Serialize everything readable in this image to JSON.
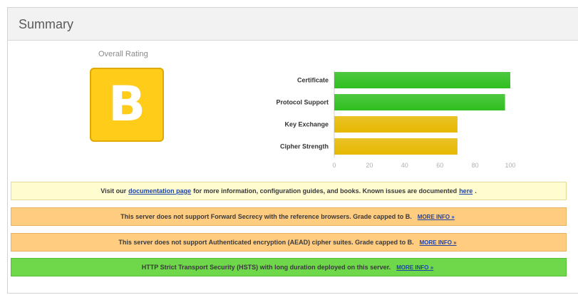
{
  "panel": {
    "title": "Summary"
  },
  "rating": {
    "label": "Overall Rating",
    "grade": "B"
  },
  "colors": {
    "pass": "#2fbf1f",
    "warn": "#e6b800",
    "grade_bg": "#ffcc1a",
    "info_bg": "#fffccf",
    "warning_bg": "#ffcc80",
    "success_bg": "#6ed84a"
  },
  "chart_data": {
    "type": "bar",
    "orientation": "horizontal",
    "categories": [
      "Certificate",
      "Protocol Support",
      "Key Exchange",
      "Cipher Strength"
    ],
    "values": [
      100,
      97,
      70,
      70
    ],
    "colors": [
      "pass",
      "pass",
      "warn",
      "warn"
    ],
    "xlim": [
      0,
      100
    ],
    "ticks": [
      0,
      20,
      40,
      60,
      80,
      100
    ],
    "grid": false
  },
  "notices": {
    "info": {
      "before": "Visit our",
      "link1": "documentation page",
      "middle": "for more information, configuration guides, and books. Known issues are documented",
      "link2": "here",
      "after": "."
    },
    "warn1": {
      "text": "This server does not support Forward Secrecy with the reference browsers. Grade capped to B.",
      "more": "MORE INFO »"
    },
    "warn2": {
      "text": "This server does not support Authenticated encryption (AEAD) cipher suites. Grade capped to B.",
      "more": "MORE INFO »"
    },
    "good": {
      "text": "HTTP Strict Transport Security (HSTS) with long duration deployed on this server.",
      "more": "MORE INFO »"
    }
  }
}
